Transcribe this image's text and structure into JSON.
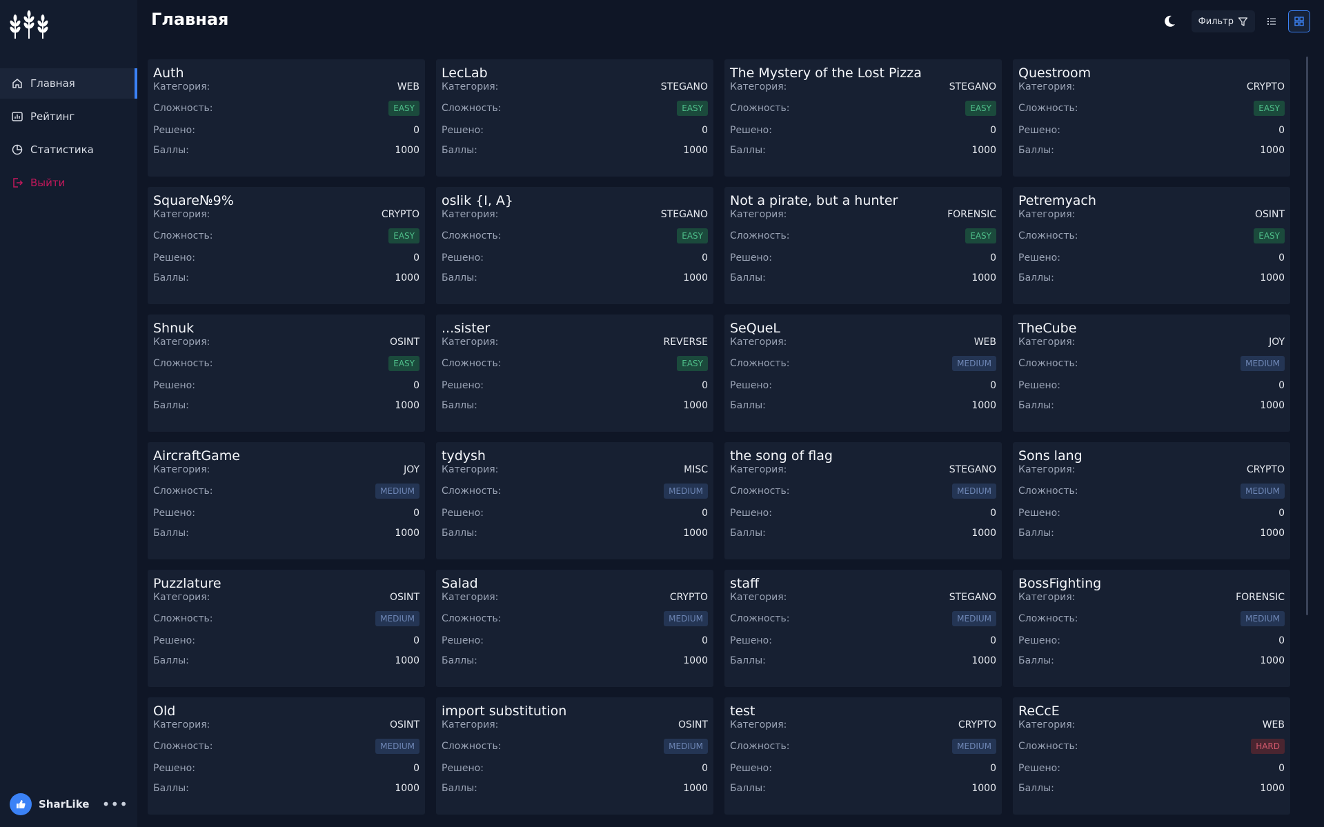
{
  "sidebar": {
    "logo": "wheat-logo",
    "items": [
      {
        "label": "Главная",
        "icon": "home-icon",
        "active": true
      },
      {
        "label": "Рейтинг",
        "icon": "bar-chart-icon",
        "active": false
      },
      {
        "label": "Статистика",
        "icon": "pie-chart-icon",
        "active": false
      },
      {
        "label": "Выйти",
        "icon": "logout-icon",
        "active": false
      }
    ],
    "user": {
      "name": "SharLike",
      "more": "•••"
    }
  },
  "header": {
    "title": "Главная"
  },
  "toolbar": {
    "filter_label": "Фильтр"
  },
  "labels": {
    "category": "Категория:",
    "difficulty": "Сложность:",
    "solved": "Решено:",
    "points": "Баллы:"
  },
  "colors": {
    "accent": "#3b82f6",
    "easy": "#4fbf8a",
    "medium": "#6e86b5",
    "hard": "#d1586b",
    "logout": "#c2185b"
  },
  "tasks": [
    {
      "title": "Auth",
      "category": "WEB",
      "difficulty": "EASY",
      "solved": "0",
      "points": "1000"
    },
    {
      "title": "LecLab",
      "category": "STEGANO",
      "difficulty": "EASY",
      "solved": "0",
      "points": "1000"
    },
    {
      "title": "The Mystery of the Lost Pizza",
      "category": "STEGANO",
      "difficulty": "EASY",
      "solved": "0",
      "points": "1000"
    },
    {
      "title": "Questroom",
      "category": "CRYPTO",
      "difficulty": "EASY",
      "solved": "0",
      "points": "1000"
    },
    {
      "title": "Square№9%",
      "category": "CRYPTO",
      "difficulty": "EASY",
      "solved": "0",
      "points": "1000"
    },
    {
      "title": "oslik {I, A}",
      "category": "STEGANO",
      "difficulty": "EASY",
      "solved": "0",
      "points": "1000"
    },
    {
      "title": "Not a pirate, but a hunter",
      "category": "FORENSIC",
      "difficulty": "EASY",
      "solved": "0",
      "points": "1000"
    },
    {
      "title": "Petremyach",
      "category": "OSINT",
      "difficulty": "EASY",
      "solved": "0",
      "points": "1000"
    },
    {
      "title": "Shnuk",
      "category": "OSINT",
      "difficulty": "EASY",
      "solved": "0",
      "points": "1000"
    },
    {
      "title": "...sister",
      "category": "REVERSE",
      "difficulty": "EASY",
      "solved": "0",
      "points": "1000"
    },
    {
      "title": "SeQueL",
      "category": "WEB",
      "difficulty": "MEDIUM",
      "solved": "0",
      "points": "1000"
    },
    {
      "title": "TheCube",
      "category": "JOY",
      "difficulty": "MEDIUM",
      "solved": "0",
      "points": "1000"
    },
    {
      "title": "AircraftGame",
      "category": "JOY",
      "difficulty": "MEDIUM",
      "solved": "0",
      "points": "1000"
    },
    {
      "title": "tydysh",
      "category": "MISC",
      "difficulty": "MEDIUM",
      "solved": "0",
      "points": "1000"
    },
    {
      "title": "the song of flag",
      "category": "STEGANO",
      "difficulty": "MEDIUM",
      "solved": "0",
      "points": "1000"
    },
    {
      "title": "Sons lang",
      "category": "CRYPTO",
      "difficulty": "MEDIUM",
      "solved": "0",
      "points": "1000"
    },
    {
      "title": "Puzzlature",
      "category": "OSINT",
      "difficulty": "MEDIUM",
      "solved": "0",
      "points": "1000"
    },
    {
      "title": "Salad",
      "category": "CRYPTO",
      "difficulty": "MEDIUM",
      "solved": "0",
      "points": "1000"
    },
    {
      "title": "staff",
      "category": "STEGANO",
      "difficulty": "MEDIUM",
      "solved": "0",
      "points": "1000"
    },
    {
      "title": "BossFighting",
      "category": "FORENSIC",
      "difficulty": "MEDIUM",
      "solved": "0",
      "points": "1000"
    },
    {
      "title": "Old",
      "category": "OSINT",
      "difficulty": "MEDIUM",
      "solved": "0",
      "points": "1000"
    },
    {
      "title": "import substitution",
      "category": "OSINT",
      "difficulty": "MEDIUM",
      "solved": "0",
      "points": "1000"
    },
    {
      "title": "test",
      "category": "CRYPTO",
      "difficulty": "MEDIUM",
      "solved": "0",
      "points": "1000"
    },
    {
      "title": "ReCcE",
      "category": "WEB",
      "difficulty": "HARD",
      "solved": "0",
      "points": "1000"
    }
  ]
}
